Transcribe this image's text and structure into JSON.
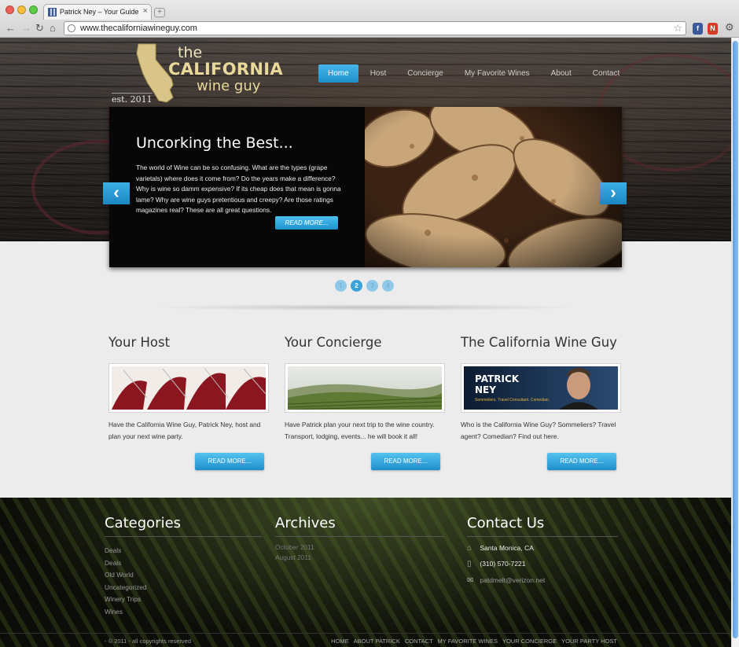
{
  "browser": {
    "tab_title": "Patrick Ney – Your Guide to...",
    "url": "www.thecaliforniawineguy.com"
  },
  "logo": {
    "line1": "the",
    "line2": "CALIFORNIA",
    "line3": "wine guy",
    "est": "est. 2011"
  },
  "nav": [
    "Home",
    "Host",
    "Concierge",
    "My Favorite Wines",
    "About",
    "Contact"
  ],
  "slider": {
    "title": "Uncorking the Best...",
    "body": "The world of Wine can be so confusing.  What are the types (grape varietals) where does it come from?  Do the years make a difference?  Why is wine so damm expensive?  If its cheap does that mean is gonna lame?  Why are wine guys pretentious and creepy?  Are those ratings magazines real? These are all great questions.",
    "button": "READ MORE...",
    "dots": [
      "1",
      "2",
      "3",
      "4"
    ],
    "active_dot": 2
  },
  "columns": [
    {
      "title": "Your Host",
      "text": "Have the California Wine Guy, Patrick Ney, host and plan your next wine party.",
      "button": "READ MORE..."
    },
    {
      "title": "Your Concierge",
      "text": "Have Patrick plan your next trip to the wine country. Transport, lodging, events... he will book it all!",
      "button": "READ MORE..."
    },
    {
      "title": "The California Wine Guy",
      "text": "Who is the California Wine Guy? Sommeliers? Travel agent? Comedian? Find out here.",
      "button": "READ MORE...",
      "banner_name_1": "PATRICK",
      "banner_name_2": "NEY",
      "banner_tagline": "Sommeliers. Travel Consultant. Comedian."
    }
  ],
  "footer": {
    "categories_title": "Categories",
    "categories": [
      "Deals",
      "Deals",
      "Old World",
      "Uncategorized",
      "Winery Trips",
      "Wines"
    ],
    "archives_title": "Archives",
    "archives": [
      "October 2011",
      "August 2011"
    ],
    "contact_title": "Contact Us",
    "contact": {
      "location": "Santa Monica, CA",
      "phone": "(310) 570-7221",
      "email": "patdmelt@verizon.net"
    },
    "copyright": "- © 2011 - all copyrights reserved",
    "links": [
      "HOME",
      "ABOUT PATRICK",
      "CONTACT",
      "MY FAVORITE WINES",
      "YOUR CONCIERGE",
      "YOUR PARTY HOST"
    ]
  },
  "colors": {
    "accent": "#2aa0dc",
    "header_dark": "#2b2624",
    "body_bg": "#ececec"
  },
  "icons": [
    "back-icon",
    "forward-icon",
    "reload-icon",
    "home-icon",
    "globe-icon",
    "star-icon",
    "wrench-icon",
    "home-location-icon",
    "phone-icon",
    "mail-icon",
    "chevron-left-icon",
    "chevron-right-icon"
  ]
}
